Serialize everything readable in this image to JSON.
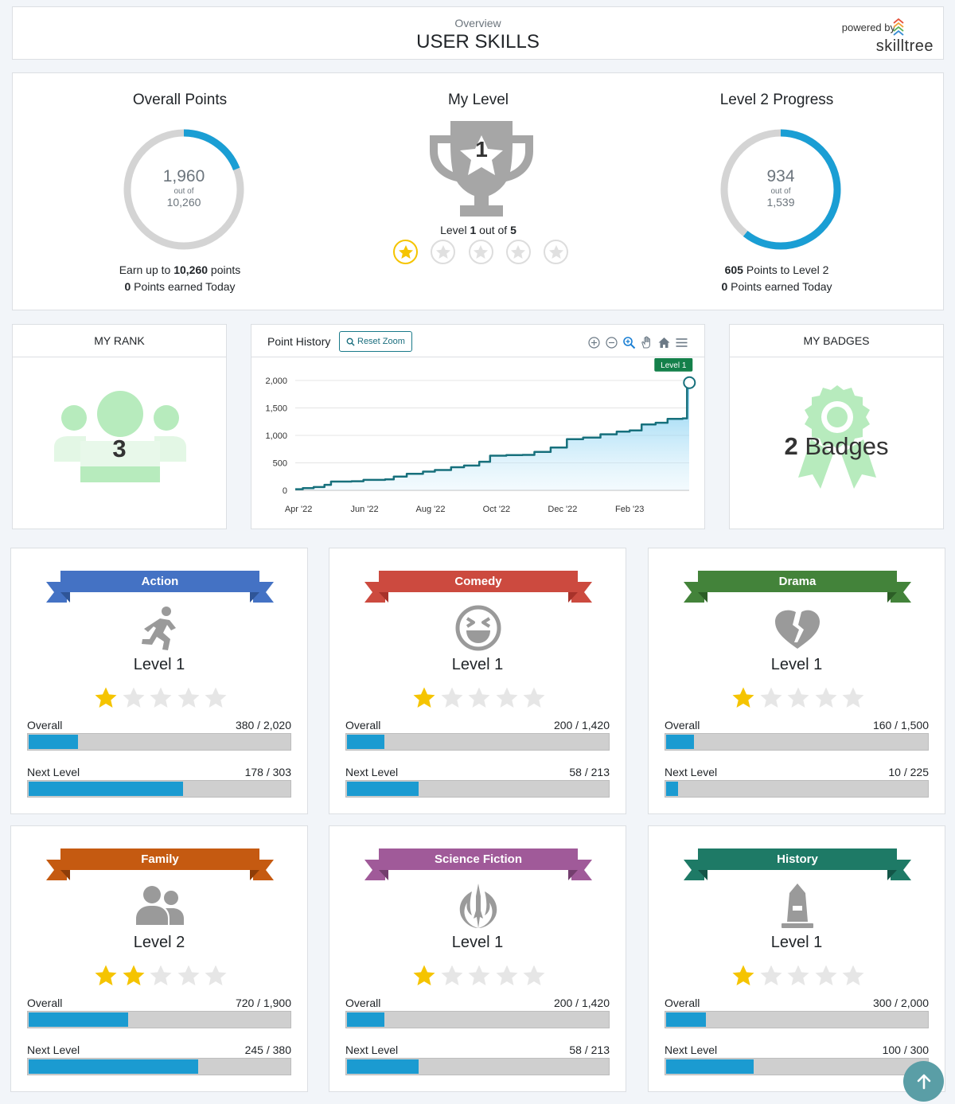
{
  "header": {
    "subtitle": "Overview",
    "title": "USER SKILLS",
    "powered_by": "powered by",
    "brand": "skilltree"
  },
  "summary": {
    "overall": {
      "title": "Overall Points",
      "value": "1,960",
      "out_of": "out of",
      "total": "10,260",
      "fraction": 0.191,
      "line1_prefix": "Earn up to ",
      "line1_bold": "10,260",
      "line1_suffix": " points",
      "line2_bold": "0",
      "line2_suffix": " Points earned Today"
    },
    "level": {
      "title": "My Level",
      "number": "1",
      "text_prefix": "Level ",
      "current": "1",
      "text_mid": " out of ",
      "max": "5",
      "stars_earned": 1,
      "stars_total": 5
    },
    "progress": {
      "title": "Level 2 Progress",
      "value": "934",
      "out_of": "out of",
      "total": "1,539",
      "fraction": 0.607,
      "line1_bold": "605",
      "line1_suffix": " Points to Level 2",
      "line2_bold": "0",
      "line2_suffix": " Points earned Today"
    }
  },
  "rank": {
    "title": "MY RANK",
    "value": "3"
  },
  "history": {
    "title": "Point History",
    "reset_label": "Reset Zoom",
    "annotation": "Level 1"
  },
  "badges": {
    "title": "MY BADGES",
    "count": "2",
    "label": " Badges"
  },
  "chart_data": {
    "type": "area",
    "title": "",
    "xlabel": "",
    "ylabel": "",
    "ylim": [
      0,
      2000
    ],
    "y_ticks": [
      "0",
      "500",
      "1,000",
      "1,500",
      "2,000"
    ],
    "x_ticks": [
      "Apr '22",
      "Jun '22",
      "Aug '22",
      "Oct '22",
      "Dec '22",
      "Feb '23"
    ],
    "x_tick_dates": [
      "2022-04-01",
      "2022-06-01",
      "2022-08-01",
      "2022-10-01",
      "2022-12-01",
      "2023-02-01"
    ],
    "x_range": [
      "2022-03-29",
      "2023-03-28"
    ],
    "series": [
      {
        "points": [
          [
            "2022-03-29",
            20
          ],
          [
            "2022-04-05",
            40
          ],
          [
            "2022-04-15",
            60
          ],
          [
            "2022-04-25",
            100
          ],
          [
            "2022-05-01",
            160
          ],
          [
            "2022-05-20",
            165
          ],
          [
            "2022-05-31",
            190
          ],
          [
            "2022-06-20",
            200
          ],
          [
            "2022-06-28",
            250
          ],
          [
            "2022-07-10",
            300
          ],
          [
            "2022-07-25",
            340
          ],
          [
            "2022-08-05",
            370
          ],
          [
            "2022-08-20",
            420
          ],
          [
            "2022-09-01",
            450
          ],
          [
            "2022-09-15",
            520
          ],
          [
            "2022-09-25",
            630
          ],
          [
            "2022-10-10",
            640
          ],
          [
            "2022-10-25",
            645
          ],
          [
            "2022-11-05",
            700
          ],
          [
            "2022-11-20",
            780
          ],
          [
            "2022-12-05",
            930
          ],
          [
            "2022-12-20",
            960
          ],
          [
            "2023-01-05",
            1020
          ],
          [
            "2023-01-20",
            1070
          ],
          [
            "2023-02-01",
            1090
          ],
          [
            "2023-02-12",
            1200
          ],
          [
            "2023-02-25",
            1230
          ],
          [
            "2023-03-08",
            1300
          ],
          [
            "2023-03-22",
            1310
          ],
          [
            "2023-03-26",
            1960
          ]
        ]
      }
    ]
  },
  "subjects": [
    {
      "name": "Action",
      "color": "#4472c4",
      "dark": "#2f5597",
      "icon": "running-person-icon",
      "level": "Level 1",
      "stars": 1,
      "overall_label": "Overall",
      "overall_value": "380 / 2,020",
      "overall_frac": 0.188,
      "next_label": "Next Level",
      "next_value": "178 / 303",
      "next_frac": 0.587
    },
    {
      "name": "Comedy",
      "color": "#cc4a3f",
      "dark": "#a8322a",
      "icon": "laughing-face-icon",
      "level": "Level 1",
      "stars": 1,
      "overall_label": "Overall",
      "overall_value": "200 / 1,420",
      "overall_frac": 0.141,
      "next_label": "Next Level",
      "next_value": "58 / 213",
      "next_frac": 0.272
    },
    {
      "name": "Drama",
      "color": "#43833a",
      "dark": "#2c5e26",
      "icon": "broken-heart-icon",
      "level": "Level 1",
      "stars": 1,
      "overall_label": "Overall",
      "overall_value": "160 / 1,500",
      "overall_frac": 0.107,
      "next_label": "Next Level",
      "next_value": "10 / 225",
      "next_frac": 0.044
    },
    {
      "name": "Family",
      "color": "#c55a11",
      "dark": "#8e3d08",
      "icon": "user-group-icon",
      "level": "Level 2",
      "stars": 2,
      "overall_label": "Overall",
      "overall_value": "720 / 1,900",
      "overall_frac": 0.379,
      "next_label": "Next Level",
      "next_value": "245 / 380",
      "next_frac": 0.645
    },
    {
      "name": "Science Fiction",
      "color": "#a05a99",
      "dark": "#733e6e",
      "icon": "jedi-order-icon",
      "level": "Level 1",
      "stars": 1,
      "overall_label": "Overall",
      "overall_value": "200 / 1,420",
      "overall_frac": 0.141,
      "next_label": "Next Level",
      "next_value": "58 / 213",
      "next_frac": 0.272
    },
    {
      "name": "History",
      "color": "#1e7a66",
      "dark": "#135547",
      "icon": "monument-icon",
      "level": "Level 1",
      "stars": 1,
      "overall_label": "Overall",
      "overall_value": "300 / 2,000",
      "overall_frac": 0.15,
      "next_label": "Next Level",
      "next_value": "100 / 300",
      "next_frac": 0.333
    }
  ]
}
